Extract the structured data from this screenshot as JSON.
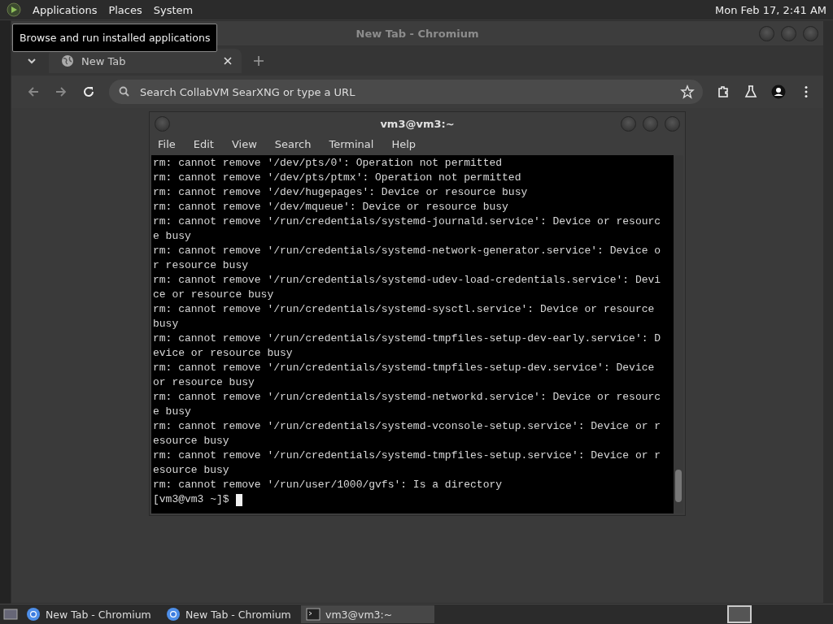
{
  "top_panel": {
    "menus": [
      "Applications",
      "Places",
      "System"
    ],
    "clock": "Mon Feb 17,  2:41 AM"
  },
  "tooltip": "Browse and run installed applications",
  "browser": {
    "title": "New Tab - Chromium",
    "tabs": [
      {
        "label": "New Tab",
        "selected": true
      }
    ],
    "address_placeholder": "Search CollabVM SearXNG or type a URL"
  },
  "terminal": {
    "title": "vm3@vm3:~",
    "menus": [
      "File",
      "Edit",
      "View",
      "Search",
      "Terminal",
      "Help"
    ],
    "lines": [
      "rm: cannot remove '/dev/pts/0': Operation not permitted",
      "rm: cannot remove '/dev/pts/ptmx': Operation not permitted",
      "rm: cannot remove '/dev/hugepages': Device or resource busy",
      "rm: cannot remove '/dev/mqueue': Device or resource busy",
      "rm: cannot remove '/run/credentials/systemd-journald.service': Device or resourc",
      "e busy",
      "rm: cannot remove '/run/credentials/systemd-network-generator.service': Device o",
      "r resource busy",
      "rm: cannot remove '/run/credentials/systemd-udev-load-credentials.service': Devi",
      "ce or resource busy",
      "rm: cannot remove '/run/credentials/systemd-sysctl.service': Device or resource",
      "busy",
      "rm: cannot remove '/run/credentials/systemd-tmpfiles-setup-dev-early.service': D",
      "evice or resource busy",
      "rm: cannot remove '/run/credentials/systemd-tmpfiles-setup-dev.service': Device",
      "or resource busy",
      "rm: cannot remove '/run/credentials/systemd-networkd.service': Device or resourc",
      "e busy",
      "rm: cannot remove '/run/credentials/systemd-vconsole-setup.service': Device or r",
      "esource busy",
      "rm: cannot remove '/run/credentials/systemd-tmpfiles-setup.service': Device or r",
      "esource busy",
      "rm: cannot remove '/run/user/1000/gvfs': Is a directory"
    ],
    "prompt": "[vm3@vm3 ~]$"
  },
  "taskbar": [
    {
      "label": "New Tab - Chromium",
      "kind": "browser",
      "selected": false
    },
    {
      "label": "New Tab - Chromium",
      "kind": "browser",
      "selected": false
    },
    {
      "label": "vm3@vm3:~",
      "kind": "terminal",
      "selected": true
    }
  ]
}
